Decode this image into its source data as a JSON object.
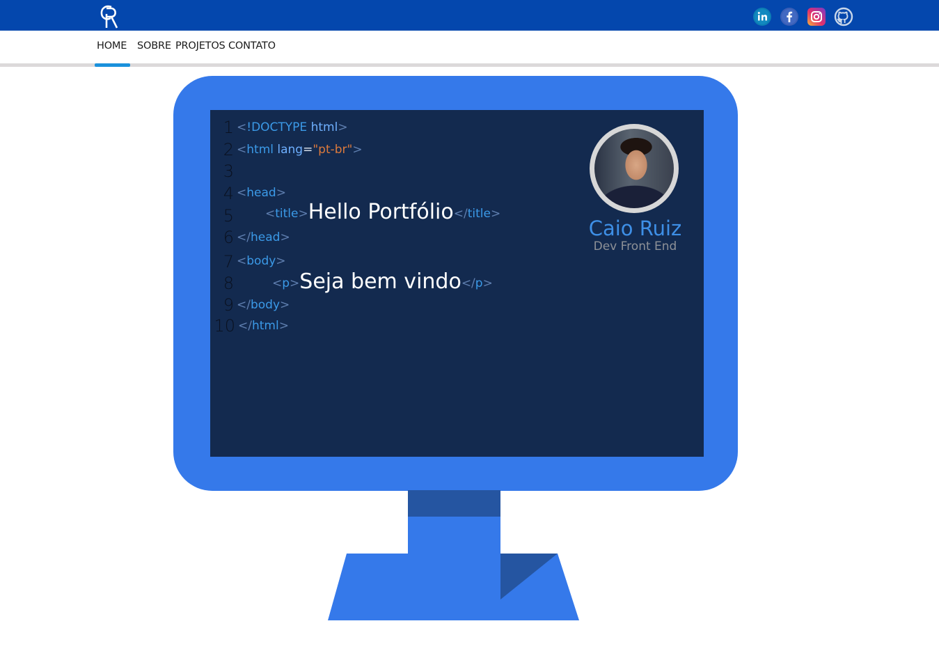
{
  "header": {
    "logo_text": "CR",
    "social": [
      "linkedin-icon",
      "facebook-icon",
      "instagram-icon",
      "github-icon"
    ]
  },
  "nav": {
    "items": [
      {
        "label": "HOME",
        "active": true
      },
      {
        "label": "SOBRE"
      },
      {
        "label": "PROJETOS"
      },
      {
        "label": "CONTATO"
      }
    ]
  },
  "code": {
    "line_numbers": [
      "1",
      "2",
      "3",
      "4",
      "5",
      "6",
      "7",
      "8",
      "9",
      "10"
    ],
    "doctype_kw": "!DOCTYPE",
    "doctype_val": "html",
    "html_tag": "html",
    "lang_attr": "lang",
    "lang_eq": "=",
    "lang_val": "\"pt-br\"",
    "head_tag": "head",
    "title_tag": "title",
    "title_text": "Hello Portfólio",
    "body_tag": "body",
    "p_tag": "p",
    "p_text": "Seja bem vindo"
  },
  "profile": {
    "name": "Caio Ruiz",
    "role": "Dev Front End"
  },
  "colors": {
    "topbar": "#0447ad",
    "monitor": "#3579ea",
    "screen": "#132a4f",
    "accent": "#1a91dc"
  }
}
